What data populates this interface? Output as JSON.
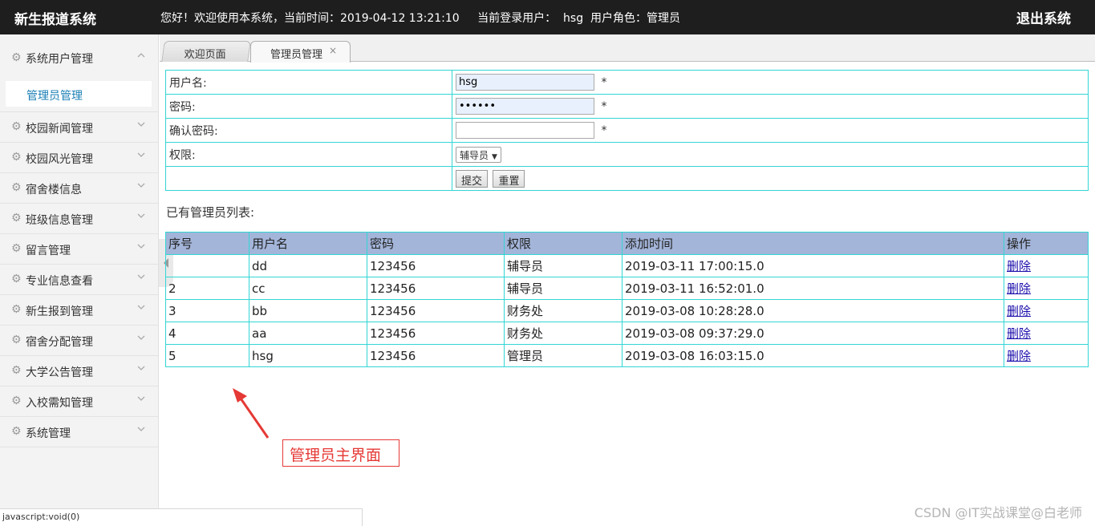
{
  "header": {
    "brand": "新生报道系统",
    "greeting": "您好！欢迎使用本系统，当前时间：2019-04-12 13:21:10",
    "current_user": "当前登录用户：  hsg  用户角色：管理员",
    "logout": "退出系统"
  },
  "sidebar": {
    "items": [
      {
        "label": "系统用户管理",
        "expanded": true,
        "children": [
          {
            "label": "管理员管理"
          }
        ]
      },
      {
        "label": "校园新闻管理"
      },
      {
        "label": "校园风光管理"
      },
      {
        "label": "宿舍楼信息"
      },
      {
        "label": "班级信息管理"
      },
      {
        "label": "留言管理"
      },
      {
        "label": "专业信息查看"
      },
      {
        "label": "新生报到管理"
      },
      {
        "label": "宿舍分配管理"
      },
      {
        "label": "大学公告管理"
      },
      {
        "label": "入校需知管理"
      },
      {
        "label": "系统管理"
      }
    ]
  },
  "tabs": [
    {
      "label": "欢迎页面",
      "active": false
    },
    {
      "label": "管理员管理",
      "active": true,
      "close": "×"
    }
  ],
  "form": {
    "username_label": "用户名:",
    "username_value": "hsg",
    "password_label": "密码:",
    "password_value": "••••••",
    "confirm_label": "确认密码:",
    "confirm_value": "",
    "role_label": "权限:",
    "role_value": "辅导员",
    "required": "*",
    "submit": "提交",
    "reset": "重置"
  },
  "list": {
    "title": "已有管理员列表:",
    "headers": [
      "序号",
      "用户名",
      "密码",
      "权限",
      "添加时间",
      "操作"
    ],
    "rows": [
      [
        "",
        "dd",
        "123456",
        "辅导员",
        "2019-03-11 17:00:15.0",
        "删除"
      ],
      [
        "2",
        "cc",
        "123456",
        "辅导员",
        "2019-03-11 16:52:01.0",
        "删除"
      ],
      [
        "3",
        "bb",
        "123456",
        "财务处",
        "2019-03-08 10:28:28.0",
        "删除"
      ],
      [
        "4",
        "aa",
        "123456",
        "财务处",
        "2019-03-08 09:37:29.0",
        "删除"
      ],
      [
        "5",
        "hsg",
        "123456",
        "管理员",
        "2019-03-08 16:03:15.0",
        "删除"
      ]
    ]
  },
  "annotation": "管理员主界面",
  "status_bar": "javascript:void(0)",
  "watermark": "CSDN @IT实战课堂@白老师",
  "colors": {
    "header_bg": "#1e1e1e",
    "table_border": "#33d5d5",
    "table_header_bg": "#a3b5d9",
    "annotation": "#e53935",
    "link": "#1a0dab"
  }
}
